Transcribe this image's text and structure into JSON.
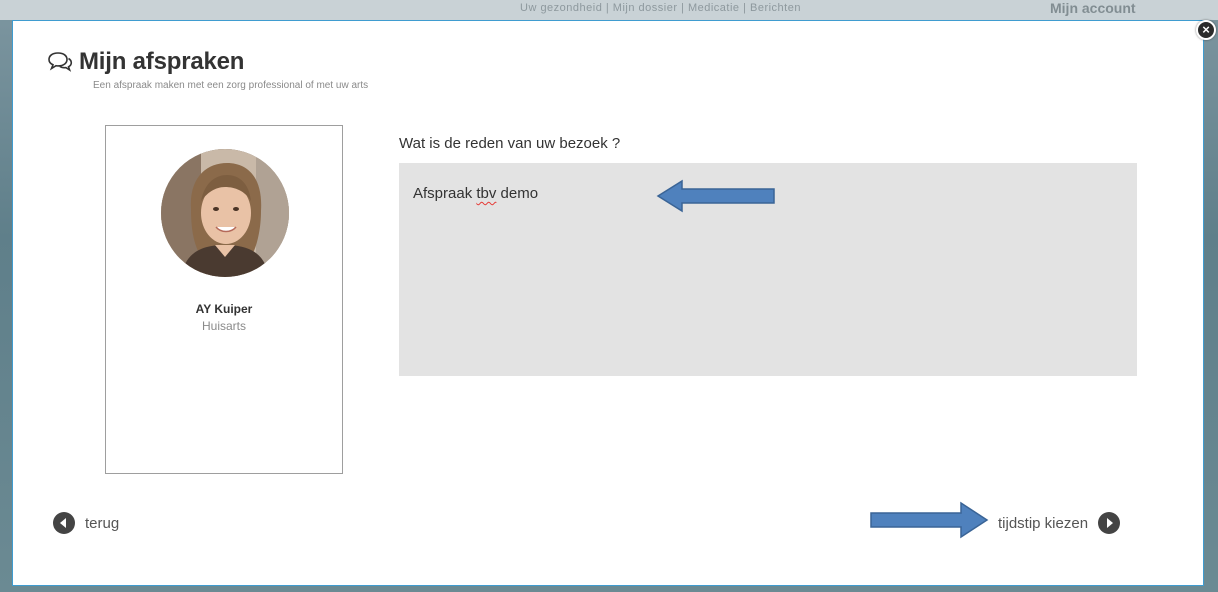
{
  "background": {
    "nav_text": "Uw gezondheid  |  Mijn dossier  |  Medicatie  |  Berichten",
    "account_text": "Mijn account"
  },
  "modal": {
    "title": "Mijn afspraken",
    "subtitle": "Een afspraak maken met een zorg professional of met uw arts",
    "close_symbol": "×"
  },
  "doctor": {
    "name": "AY Kuiper",
    "role": "Huisarts"
  },
  "reason": {
    "question": "Wat is de reden van uw bezoek ?",
    "value_prefix": "Afspraak ",
    "value_misspelled": "tbv",
    "value_suffix": " demo"
  },
  "footer": {
    "back_label": "terug",
    "next_label": "tijdstip kiezen"
  },
  "colors": {
    "modal_border": "#3f9cd0",
    "textarea_bg": "#e3e3e3",
    "arrow_fill": "#4f81bd",
    "nav_circle": "#444444"
  },
  "icons": {
    "title_icon": "chat-bubbles-icon",
    "close_icon": "close-icon",
    "back_icon": "chevron-left-circle-icon",
    "next_icon": "chevron-right-circle-icon"
  }
}
